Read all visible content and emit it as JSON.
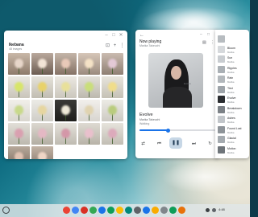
{
  "gallery": {
    "title": "Ikebana",
    "subtitle": "48 images",
    "window_controls": [
      "minimize-icon",
      "maximize-icon",
      "close-icon"
    ],
    "toolbar_icons": [
      "select-icon",
      "add-icon",
      "more-icon"
    ]
  },
  "music": {
    "header": "Now playing",
    "artist_top": "Marika Takeuchi",
    "song_title": "Evolve",
    "song_artist": "Marika Takeuchi",
    "song_album": "Walking",
    "album_text": "Evolve",
    "progress": 0.38,
    "controls": [
      "shuffle-icon",
      "previous-icon",
      "pause-icon",
      "next-icon",
      "repeat-icon"
    ],
    "colors": {
      "accent": "#1a73e8",
      "play_bg": "#c7d7e6"
    }
  },
  "queue": {
    "items": [
      {
        "title": "",
        "sub": "",
        "color": "#b7bcc0"
      },
      {
        "title": "Bloom",
        "sub": "Marika",
        "color": "#d6d9dc"
      },
      {
        "title": "Sun",
        "sub": "Marika",
        "color": "#c9cdd1"
      },
      {
        "title": "Ripples",
        "sub": "Marika",
        "color": "#aab0b5"
      },
      {
        "title": "Rain",
        "sub": "Marika",
        "color": "#b3b8bc"
      },
      {
        "title": "Tied",
        "sub": "Marika",
        "color": "#9ea4a9"
      },
      {
        "title": "Evolve",
        "sub": "Marika",
        "color": "#2b2d30"
      },
      {
        "title": "Breakdown",
        "sub": "Marika",
        "color": "#7d8287"
      },
      {
        "title": "Ashes",
        "sub": "Marika",
        "color": "#c2c6ca"
      },
      {
        "title": "Found Lost",
        "sub": "Marika",
        "color": "#8e9499"
      },
      {
        "title": "Glacial",
        "sub": "Marika",
        "color": "#a5abb0"
      },
      {
        "title": "Motion",
        "sub": "Marika",
        "color": "#6f757a"
      }
    ]
  },
  "shelf": {
    "apps": [
      {
        "name": "gmail-icon",
        "color": "#ea4335"
      },
      {
        "name": "docs-icon",
        "color": "#4285f4"
      },
      {
        "name": "youtube-icon",
        "color": "#d93025"
      },
      {
        "name": "photos-icon",
        "color": "#34a853"
      },
      {
        "name": "files-icon",
        "color": "#1a73e8"
      },
      {
        "name": "play-store-icon",
        "color": "#0f9d58"
      },
      {
        "name": "chrome-icon",
        "color": "#fbbc04"
      },
      {
        "name": "meet-icon",
        "color": "#00897b"
      },
      {
        "name": "camera-icon",
        "color": "#5f6368"
      },
      {
        "name": "calendar-icon",
        "color": "#1a73e8"
      },
      {
        "name": "drive-icon",
        "color": "#f9ab00"
      },
      {
        "name": "settings-icon",
        "color": "#80868b"
      },
      {
        "name": "sheets-icon",
        "color": "#0f9d58"
      },
      {
        "name": "music-icon",
        "color": "#e8710a"
      }
    ],
    "status_text": "4:48"
  }
}
